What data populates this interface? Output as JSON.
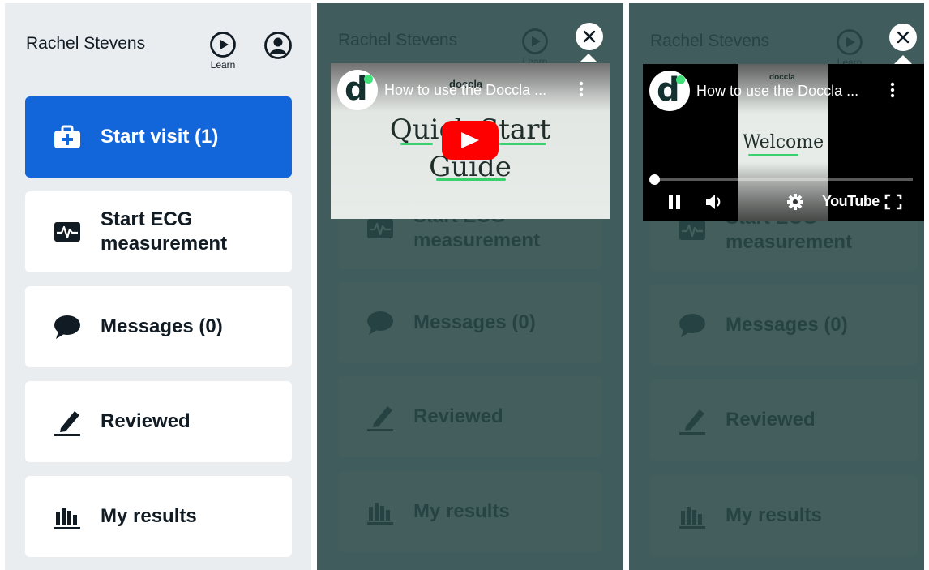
{
  "user": {
    "name": "Rachel Stevens",
    "learn_label": "Learn"
  },
  "menu": [
    {
      "label": "Start visit (1)",
      "icon": "medical-kit-icon"
    },
    {
      "label": "Start ECG measurement",
      "icon": "ecg-icon"
    },
    {
      "label": "Messages (0)",
      "icon": "chat-bubble-icon"
    },
    {
      "label": "Reviewed",
      "icon": "pen-icon"
    },
    {
      "label": "My results",
      "icon": "bar-chart-icon"
    }
  ],
  "video": {
    "title": "How to use the Doccla ...",
    "channel_initial": "d",
    "brand": "doccla",
    "thumbnail_lines": [
      "Quick Start",
      "Guide"
    ],
    "playing_caption": "Welcome",
    "youtube_label": "YouTube"
  },
  "colors": {
    "primary": "#1366d9",
    "overlay": "#294847",
    "text": "#111b24",
    "brand_green": "#3fe07a",
    "youtube_red": "#ff0000"
  }
}
